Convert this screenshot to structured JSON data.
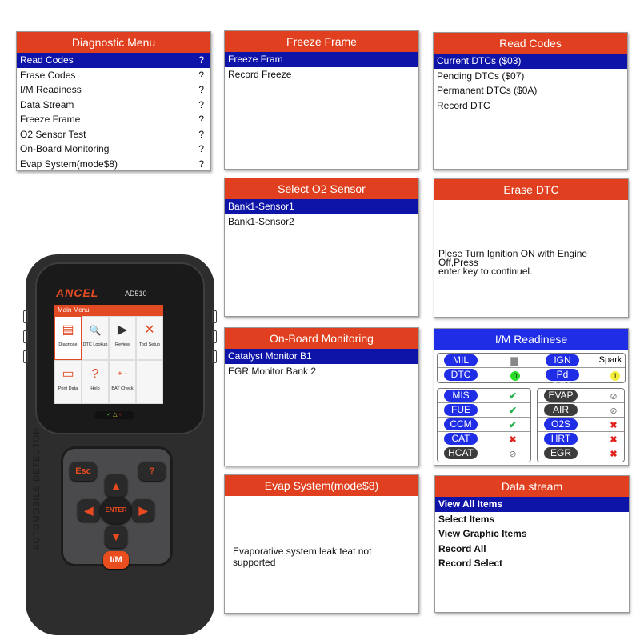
{
  "diagnostic_menu": {
    "title": "Diagnostic Menu",
    "items": [
      {
        "label": "Read Codes",
        "help": "?"
      },
      {
        "label": "Erase Codes",
        "help": "?"
      },
      {
        "label": "I/M Readiness",
        "help": "?"
      },
      {
        "label": "Data Stream",
        "help": "?"
      },
      {
        "label": "Freeze Frame",
        "help": "?"
      },
      {
        "label": "O2 Sensor Test",
        "help": "?"
      },
      {
        "label": "On-Board Monitoring",
        "help": "?"
      },
      {
        "label": "Evap System(mode$8)",
        "help": "?"
      }
    ],
    "selected_index": 0
  },
  "freeze_frame": {
    "title": "Freeze Frame",
    "items": [
      "Freeze Fram",
      "Record Freeze"
    ],
    "selected_index": 0
  },
  "read_codes": {
    "title": "Read Codes",
    "items": [
      "Current DTCs ($03)",
      "Pending DTCs ($07)",
      "Permanent DTCs ($0A)",
      "Record DTC"
    ],
    "selected_index": 0
  },
  "select_o2": {
    "title": "Select O2 Sensor",
    "items": [
      "Bank1-Sensor1",
      "Bank1-Sensor2"
    ],
    "selected_index": 0
  },
  "erase_dtc": {
    "title": "Erase DTC",
    "message_line1": "Plese Turn Ignition ON with Engine Off,Press",
    "message_line2": "enter key to continuel."
  },
  "onboard_monitoring": {
    "title": "On-Board Monitoring",
    "items": [
      "Catalyst Monitor B1",
      "EGR Monitor Bank 2"
    ],
    "selected_index": 0
  },
  "im_readiness": {
    "title": "I/M Readinese",
    "top": {
      "mil_label": "MIL",
      "mil_icon": "engine-icon",
      "ign_label": "IGN",
      "ign_value": "Spark",
      "dtc_label": "DTC",
      "dtc_value": "0",
      "pd_dtc_label": "Pd DTC",
      "pd_dtc_value": "1"
    },
    "left_monitors": [
      {
        "label": "MIS",
        "status": "complete",
        "symbol": "✔"
      },
      {
        "label": "FUE",
        "status": "complete",
        "symbol": "✔"
      },
      {
        "label": "CCM",
        "status": "complete",
        "symbol": "✔"
      },
      {
        "label": "CAT",
        "status": "incomplete",
        "symbol": "✖"
      },
      {
        "label": "HCAT",
        "status": "not-supported",
        "symbol": "⊘"
      }
    ],
    "right_monitors": [
      {
        "label": "EVAP",
        "status": "not-supported",
        "symbol": "⊘"
      },
      {
        "label": "AIR",
        "status": "not-supported",
        "symbol": "⊘"
      },
      {
        "label": "O2S",
        "status": "incomplete",
        "symbol": "✖"
      },
      {
        "label": "HRT",
        "status": "incomplete",
        "symbol": "✖"
      },
      {
        "label": "EGR",
        "status": "incomplete",
        "symbol": "✖"
      }
    ]
  },
  "evap_system": {
    "title": "Evap System(mode$8)",
    "message": "Evaporative system leak teat not supported"
  },
  "data_stream": {
    "title": "Data stream",
    "items": [
      "View All Items",
      "Select Items",
      "View Graphic Items",
      "Record All",
      "Record Select"
    ],
    "selected_index": 0
  },
  "device": {
    "brand": "ANCEL",
    "model": "AD510",
    "side_text": "AUTOMOBILE   DETECTOR",
    "screen": {
      "title": "Main Menu",
      "tiles": [
        {
          "label": "Diagnose",
          "icon": "engine-icon",
          "glyph": "▤"
        },
        {
          "label": "DTC Lookup",
          "icon": "magnifier-doc-icon",
          "glyph": "🔍"
        },
        {
          "label": "Review",
          "icon": "clapperboard-icon",
          "glyph": "▶"
        },
        {
          "label": "Tool Setup",
          "icon": "tools-icon",
          "glyph": "✕"
        },
        {
          "label": "Print Data",
          "icon": "printer-icon",
          "glyph": "▭"
        },
        {
          "label": "Help",
          "icon": "help-icon",
          "glyph": "?"
        },
        {
          "label": "BAT Check",
          "icon": "battery-icon",
          "glyph": "+ -"
        },
        {
          "label": "",
          "icon": "",
          "glyph": ""
        }
      ]
    },
    "leds": [
      "✓",
      "△",
      "○"
    ],
    "keys": {
      "esc": "Esc",
      "help": "?",
      "up": "▲",
      "down": "▼",
      "left": "◀",
      "right": "▶",
      "enter": "ENTER",
      "im": "I/M"
    }
  },
  "colors": {
    "header_orange": "#e0401f",
    "selection_blue": "#0f14a8",
    "im_header_blue": "#1f2ee6",
    "pill_dark": "#3c3c3c",
    "check_green": "#22b14c",
    "cross_red": "#e0201a"
  }
}
